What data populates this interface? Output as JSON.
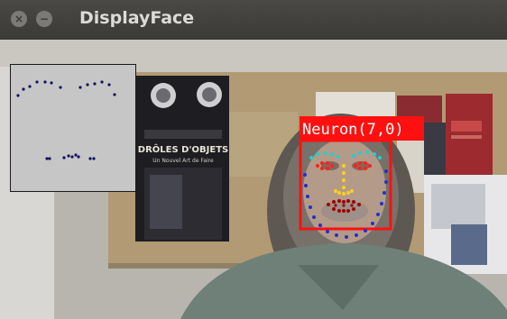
{
  "window": {
    "title": "DisplayFace",
    "close_icon": "×",
    "minimize_icon": "−"
  },
  "overlay": {
    "label": "Neuron(7,0)",
    "box_color": "#ff1010",
    "label_text_color": "#ffffff"
  },
  "landmark_colors": {
    "jaw": "#2030d0",
    "brows": "#20d0d0",
    "eyes": "#ff2020",
    "nose": "#ffd020",
    "mouth": "#a00000",
    "inset_points": "#101060"
  },
  "poster": {
    "line1": "DRÔLES D'OBJETS",
    "line2": "Un Nouvel Art de Faire"
  }
}
